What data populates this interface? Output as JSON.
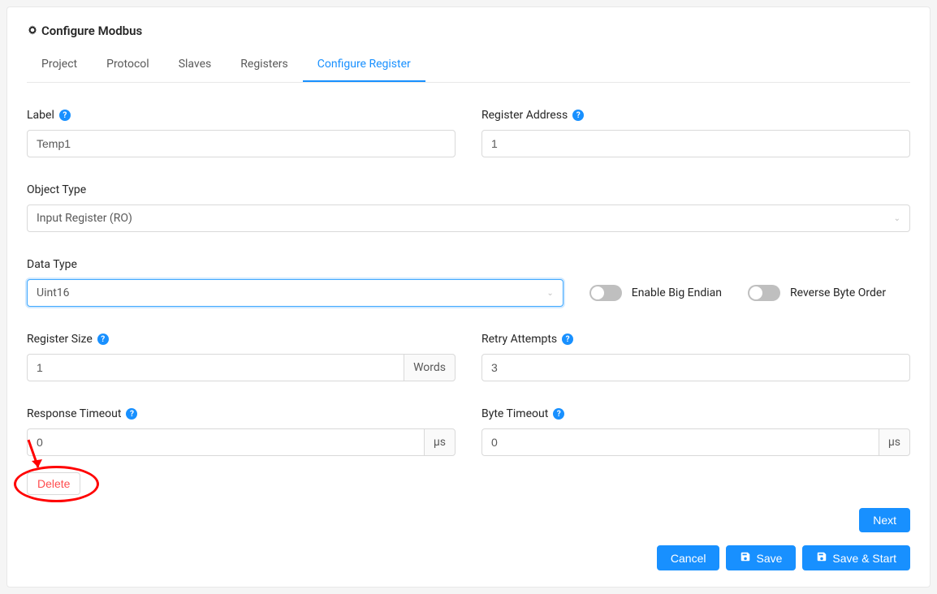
{
  "header": {
    "title": "Configure Modbus",
    "icon_name": "settings-icon"
  },
  "tabs": [
    {
      "label": "Project",
      "active": false
    },
    {
      "label": "Protocol",
      "active": false
    },
    {
      "label": "Slaves",
      "active": false
    },
    {
      "label": "Registers",
      "active": false
    },
    {
      "label": "Configure Register",
      "active": true
    }
  ],
  "fields": {
    "label": {
      "label": "Label",
      "value": "Temp1",
      "help": true
    },
    "register_address": {
      "label": "Register Address",
      "value": "1",
      "help": true
    },
    "object_type": {
      "label": "Object Type",
      "value": "Input Register (RO)",
      "help": false
    },
    "data_type": {
      "label": "Data Type",
      "value": "Uint16",
      "help": false
    },
    "enable_big_endian": {
      "label": "Enable Big Endian",
      "value": false
    },
    "reverse_byte_order": {
      "label": "Reverse Byte Order",
      "value": false
    },
    "register_size": {
      "label": "Register Size",
      "value": "1",
      "suffix": "Words",
      "help": true
    },
    "retry_attempts": {
      "label": "Retry Attempts",
      "value": "3",
      "help": true
    },
    "response_timeout": {
      "label": "Response Timeout",
      "value": "0",
      "suffix": "μs",
      "help": true
    },
    "byte_timeout": {
      "label": "Byte Timeout",
      "value": "0",
      "suffix": "μs",
      "help": true
    }
  },
  "buttons": {
    "delete": "Delete",
    "next": "Next",
    "cancel": "Cancel",
    "save": "Save",
    "save_start": "Save & Start"
  }
}
